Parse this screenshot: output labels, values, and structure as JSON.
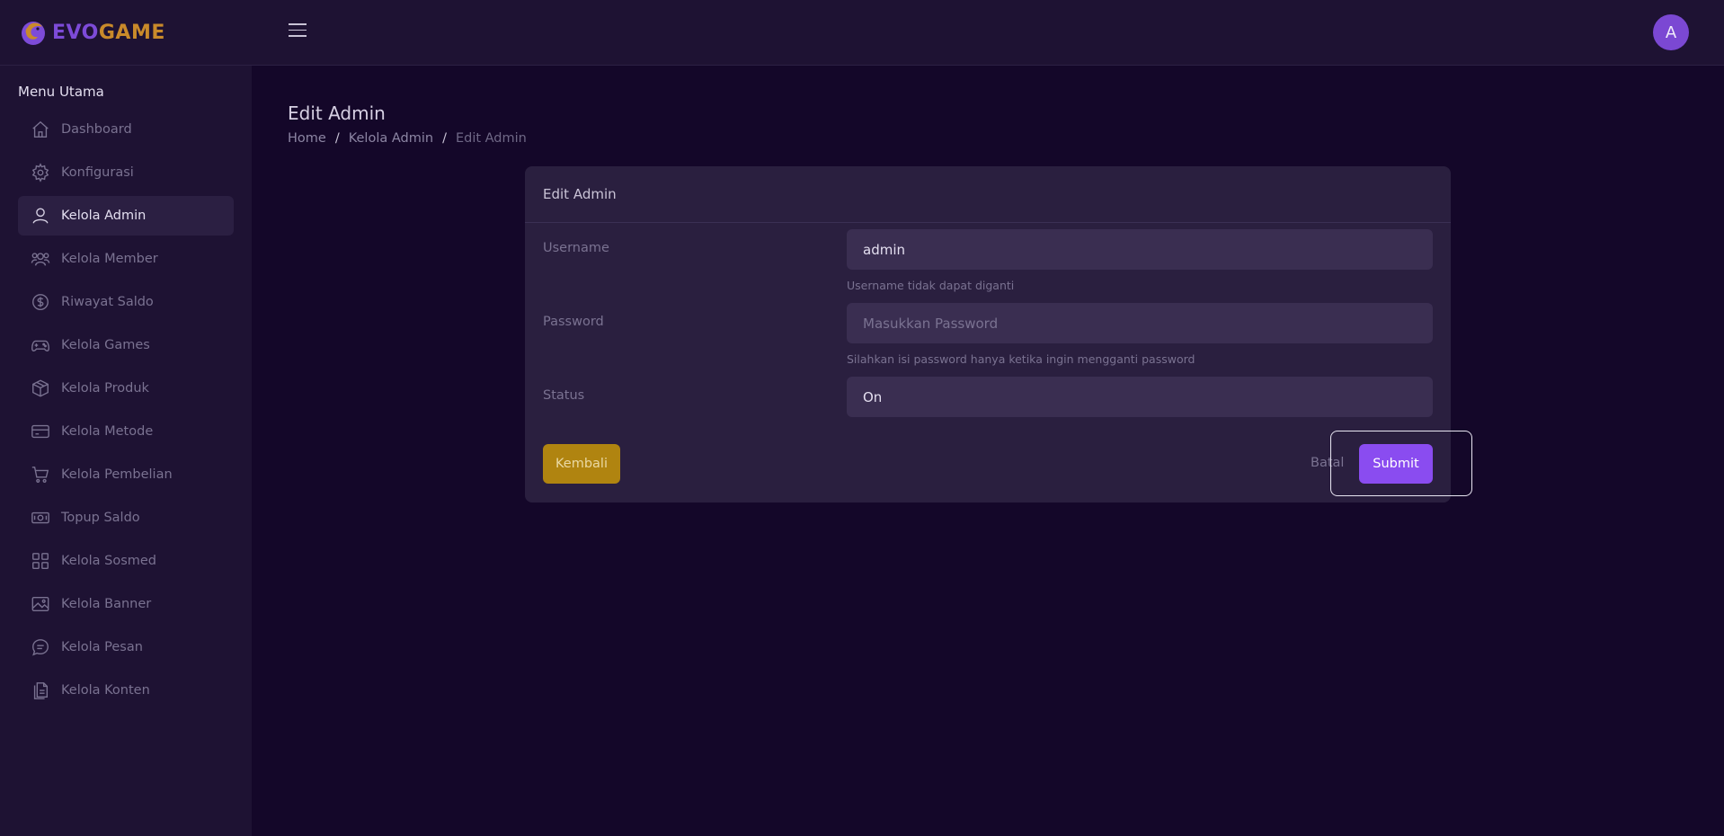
{
  "brand": {
    "name_part1": "EVO",
    "name_part2": "GAME",
    "color_primary": "#7d4bd8",
    "color_accent": "#c98a2a"
  },
  "topbar": {
    "menu_icon": "hamburger-icon",
    "avatar_initial": "A",
    "avatar_color": "#7b48d3"
  },
  "sidebar": {
    "title": "Menu Utama",
    "items": [
      {
        "label": "Dashboard",
        "icon": "home-icon",
        "active": false
      },
      {
        "label": "Konfigurasi",
        "icon": "gear-icon",
        "active": false
      },
      {
        "label": "Kelola Admin",
        "icon": "user-icon",
        "active": true
      },
      {
        "label": "Kelola Member",
        "icon": "users-icon",
        "active": false
      },
      {
        "label": "Riwayat Saldo",
        "icon": "dollar-icon",
        "active": false
      },
      {
        "label": "Kelola Games",
        "icon": "gamepad-icon",
        "active": false
      },
      {
        "label": "Kelola Produk",
        "icon": "box-icon",
        "active": false
      },
      {
        "label": "Kelola Metode",
        "icon": "credit-card-icon",
        "active": false
      },
      {
        "label": "Kelola Pembelian",
        "icon": "cart-icon",
        "active": false
      },
      {
        "label": "Topup Saldo",
        "icon": "cash-icon",
        "active": false
      },
      {
        "label": "Kelola Sosmed",
        "icon": "grid-icon",
        "active": false
      },
      {
        "label": "Kelola Banner",
        "icon": "image-icon",
        "active": false
      },
      {
        "label": "Kelola Pesan",
        "icon": "chat-icon",
        "active": false
      },
      {
        "label": "Kelola Konten",
        "icon": "document-icon",
        "active": false
      }
    ]
  },
  "page": {
    "title": "Edit Admin",
    "breadcrumb": {
      "home": "Home",
      "parent": "Kelola Admin",
      "current": "Edit Admin",
      "separator": "/"
    }
  },
  "form": {
    "card_title": "Edit Admin",
    "username": {
      "label": "Username",
      "value": "admin",
      "help": "Username tidak dapat diganti"
    },
    "password": {
      "label": "Password",
      "value": "",
      "placeholder": "Masukkan Password",
      "help": "Silahkan isi password hanya ketika ingin mengganti password"
    },
    "status": {
      "label": "Status",
      "value": "On"
    },
    "buttons": {
      "back": "Kembali",
      "cancel": "Batal",
      "submit": "Submit"
    }
  },
  "colors": {
    "submit": "#8a4cf0",
    "back": "#b08410",
    "background": "#140729",
    "panel": "#1e1233"
  }
}
